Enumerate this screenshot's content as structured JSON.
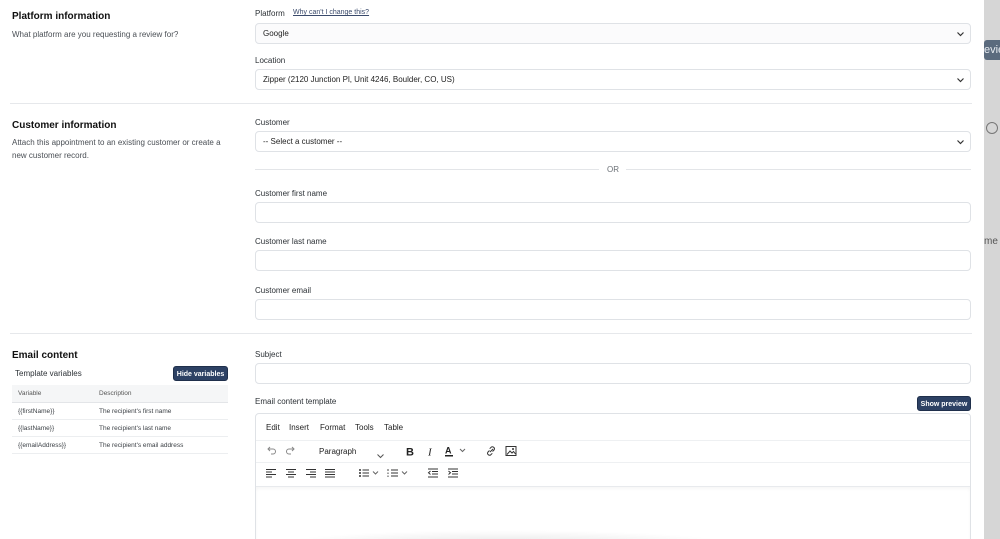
{
  "platform_section": {
    "title": "Platform information",
    "description": "What platform are you requesting a review for?",
    "platform_label": "Platform",
    "why_link": "Why can't I change this?",
    "platform_value": "Google",
    "location_label": "Location",
    "location_value": "Zipper (2120 Junction Pl, Unit 4246, Boulder, CO, US)"
  },
  "customer_section": {
    "title": "Customer information",
    "description": "Attach this appointment to an existing customer or create a new customer record.",
    "customer_label": "Customer",
    "customer_value": "-- Select a customer --",
    "or_text": "OR",
    "first_name_label": "Customer first name",
    "first_name_value": "",
    "last_name_label": "Customer last name",
    "last_name_value": "",
    "email_label": "Customer email",
    "email_value": ""
  },
  "email_section": {
    "title": "Email content",
    "variables_label": "Template variables",
    "hide_variables_button": "Hide variables",
    "variables_table": {
      "headers": [
        "Variable",
        "Description"
      ],
      "rows": [
        [
          "{{firstName}}",
          "The recipient's first name"
        ],
        [
          "{{lastName}}",
          "The recipient's last name"
        ],
        [
          "{{emailAddress}}",
          "The recipient's email address"
        ]
      ]
    },
    "subject_label": "Subject",
    "subject_value": "",
    "template_label": "Email content template",
    "show_preview_button": "Show preview",
    "editor": {
      "menu": [
        "Edit",
        "Insert",
        "Format",
        "Tools",
        "Table"
      ],
      "block_format": "Paragraph",
      "toolbar_icons": [
        "undo-icon",
        "redo-icon",
        "bold-icon",
        "italic-icon",
        "text-color-icon",
        "link-icon",
        "image-icon",
        "align-left-icon",
        "align-center-icon",
        "align-right-icon",
        "align-justify-icon",
        "bullet-list-icon",
        "numbered-list-icon",
        "outdent-icon",
        "indent-icon"
      ]
    }
  },
  "background": {
    "button_fragment": "evie",
    "text_fragment": "me"
  },
  "colors": {
    "primary_button": "#2d4164",
    "border": "#dfe2e6",
    "divider": "#e6e8eb"
  }
}
